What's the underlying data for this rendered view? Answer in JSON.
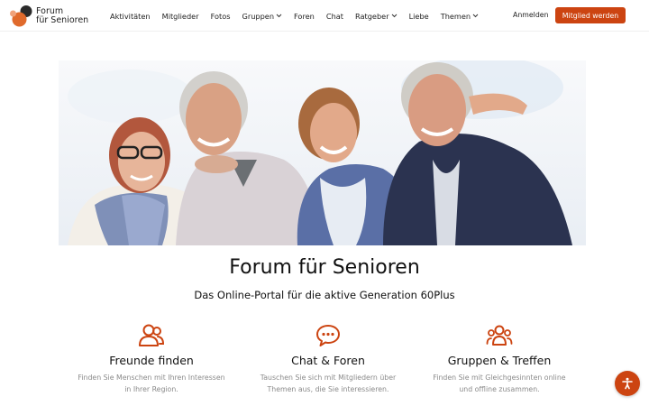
{
  "brand": {
    "line1": "Forum",
    "line2": "für Senioren",
    "logo_icon": "logo-circles-icon"
  },
  "nav": {
    "items": [
      {
        "label": "Aktivitäten",
        "dropdown": false
      },
      {
        "label": "Mitglieder",
        "dropdown": false
      },
      {
        "label": "Fotos",
        "dropdown": false
      },
      {
        "label": "Gruppen",
        "dropdown": true
      },
      {
        "label": "Foren",
        "dropdown": false
      },
      {
        "label": "Chat",
        "dropdown": false
      },
      {
        "label": "Ratgeber",
        "dropdown": true
      },
      {
        "label": "Liebe",
        "dropdown": false
      },
      {
        "label": "Themen",
        "dropdown": true
      }
    ],
    "login_label": "Anmelden",
    "signup_label": "Mitglied werden"
  },
  "hero": {
    "image_icon": "hero-photo-four-seniors"
  },
  "main": {
    "title": "Forum für Senioren",
    "subtitle": "Das Online-Portal für die aktive Generation 60Plus"
  },
  "features": [
    {
      "icon": "friends-icon",
      "title": "Freunde finden",
      "text_line1": "Finden Sie Menschen mit Ihren Interessen",
      "text_line2": "in Ihrer Region."
    },
    {
      "icon": "chat-bubble-icon",
      "title": "Chat & Foren",
      "text_line1": "Tauschen Sie sich mit Mitgliedern über",
      "text_line2": "Themen aus, die Sie interessieren."
    },
    {
      "icon": "group-icon",
      "title": "Gruppen & Treffen",
      "text_line1": "Finden Sie mit Gleichgesinnten online",
      "text_line2": "und offline zusammen."
    }
  ],
  "accessibility": {
    "icon": "accessibility-icon"
  },
  "colors": {
    "accent": "#cc4411",
    "logo_dark": "#2b2b2b",
    "logo_orange": "#e06a2c",
    "logo_light": "#f0a27a",
    "muted_text": "#8a8a8a"
  }
}
